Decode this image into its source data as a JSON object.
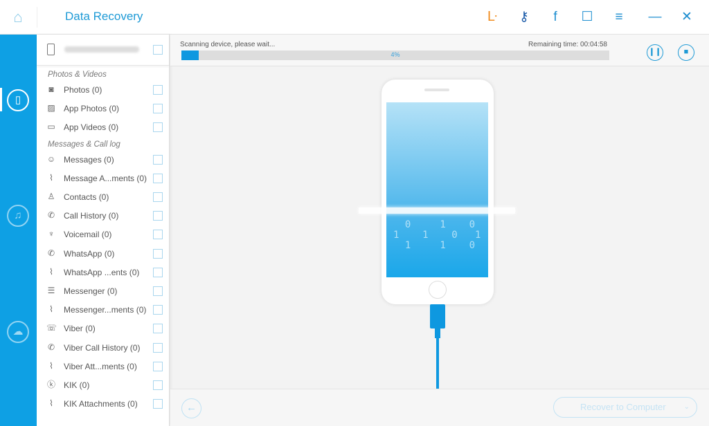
{
  "header": {
    "title": "Data Recovery",
    "icons": [
      "home-icon",
      "cart-icon",
      "key-icon",
      "facebook-icon",
      "feedback-icon",
      "menu-icon",
      "minimize-icon",
      "close-icon"
    ],
    "cart_color": "#f08c1e",
    "accent": "#0ea0e4"
  },
  "sidebar": {
    "items": [
      {
        "icon": "device-recover-icon",
        "active": true
      },
      {
        "icon": "itunes-recover-icon",
        "active": false
      },
      {
        "icon": "icloud-recover-icon",
        "active": false
      }
    ]
  },
  "panel": {
    "groups": [
      {
        "label": "Photos & Videos",
        "items": [
          {
            "label": "Photos (0)",
            "icon": "camera-icon"
          },
          {
            "label": "App Photos (0)",
            "icon": "image-icon"
          },
          {
            "label": "App Videos (0)",
            "icon": "video-icon"
          }
        ]
      },
      {
        "label": "Messages & Call log",
        "items": [
          {
            "label": "Messages (0)",
            "icon": "message-icon"
          },
          {
            "label": "Message A...ments (0)",
            "icon": "attachment-icon"
          },
          {
            "label": "Contacts (0)",
            "icon": "contact-icon"
          },
          {
            "label": "Call History (0)",
            "icon": "phone-icon"
          },
          {
            "label": "Voicemail (0)",
            "icon": "microphone-icon"
          },
          {
            "label": "WhatsApp (0)",
            "icon": "whatsapp-icon"
          },
          {
            "label": "WhatsApp ...ents (0)",
            "icon": "attachment-icon"
          },
          {
            "label": "Messenger (0)",
            "icon": "messenger-icon"
          },
          {
            "label": "Messenger...ments (0)",
            "icon": "attachment-icon"
          },
          {
            "label": "Viber (0)",
            "icon": "viber-icon"
          },
          {
            "label": "Viber Call History (0)",
            "icon": "phone-icon"
          },
          {
            "label": "Viber Att...ments (0)",
            "icon": "attachment-icon"
          },
          {
            "label": "KIK (0)",
            "icon": "kik-icon"
          },
          {
            "label": "KIK Attachments (0)",
            "icon": "attachment-icon"
          }
        ]
      }
    ]
  },
  "progress": {
    "status": "Scanning device, please wait...",
    "remaining": "Remaining time: 00:04:58",
    "percent_label": "4%",
    "percent": 4
  },
  "footer": {
    "recover_label": "Recover to Computer"
  }
}
